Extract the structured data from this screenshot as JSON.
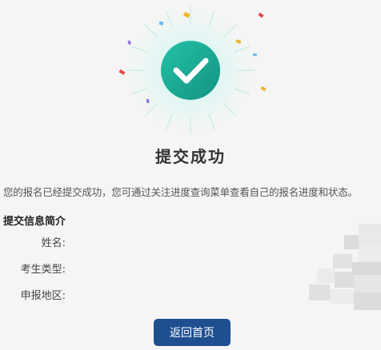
{
  "result": {
    "title": "提交成功",
    "message": "您的报名已经提交成功，您可通过关注进度查询菜单查看自己的报名进度和状态。"
  },
  "summary": {
    "heading": "提交信息简介",
    "fields": [
      {
        "label": "姓名:"
      },
      {
        "label": "考生类型:"
      },
      {
        "label": "申报地区:"
      }
    ]
  },
  "actions": {
    "home_label": "返回首页"
  },
  "colors": {
    "accent": "#1f4f91",
    "success": "#1aa89a",
    "background": "#f5f5f5"
  },
  "icons": {
    "status": "check-circle-icon"
  }
}
